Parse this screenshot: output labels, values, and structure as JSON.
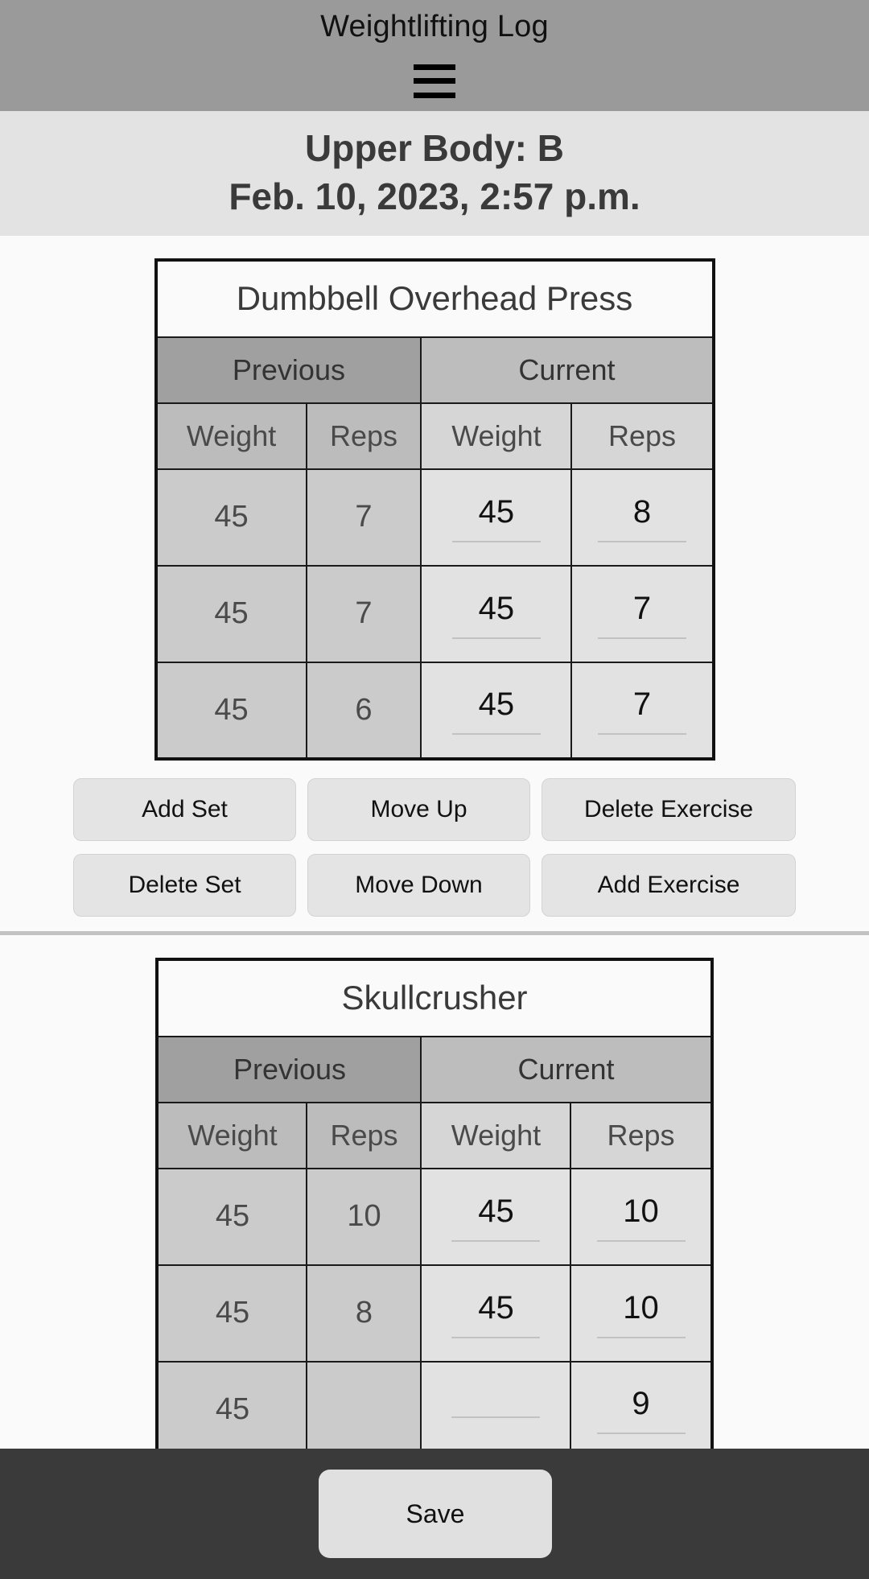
{
  "appbar": {
    "title": "Weightlifting Log",
    "menu_icon": "hamburger-menu-icon"
  },
  "workout": {
    "name": "Upper Body: B",
    "date": "Feb. 10, 2023, 2:57 p.m."
  },
  "table_headers": {
    "previous": "Previous",
    "current": "Current",
    "weight": "Weight",
    "reps": "Reps"
  },
  "buttons": {
    "add_set": "Add Set",
    "move_up": "Move Up",
    "delete_exercise": "Delete Exercise",
    "delete_set": "Delete Set",
    "move_down": "Move Down",
    "add_exercise": "Add Exercise",
    "save": "Save"
  },
  "exercises": [
    {
      "name": "Dumbbell Overhead Press",
      "sets": [
        {
          "prev_weight": "45",
          "prev_reps": "7",
          "cur_weight": "45",
          "cur_reps": "8"
        },
        {
          "prev_weight": "45",
          "prev_reps": "7",
          "cur_weight": "45",
          "cur_reps": "7"
        },
        {
          "prev_weight": "45",
          "prev_reps": "6",
          "cur_weight": "45",
          "cur_reps": "7"
        }
      ]
    },
    {
      "name": "Skullcrusher",
      "sets": [
        {
          "prev_weight": "45",
          "prev_reps": "10",
          "cur_weight": "45",
          "cur_reps": "10"
        },
        {
          "prev_weight": "45",
          "prev_reps": "8",
          "cur_weight": "45",
          "cur_reps": "10"
        },
        {
          "prev_weight": "45",
          "prev_reps": "",
          "cur_weight": "",
          "cur_reps": "9"
        }
      ]
    }
  ],
  "colors": {
    "appbar_bg": "#9a9a9a",
    "header_bg": "#e3e3e3",
    "page_bg": "#fafafa",
    "overlay_bg": "#3a3a3a",
    "prev_group_bg": "#a0a0a0",
    "curr_group_bg": "#bdbdbd"
  }
}
